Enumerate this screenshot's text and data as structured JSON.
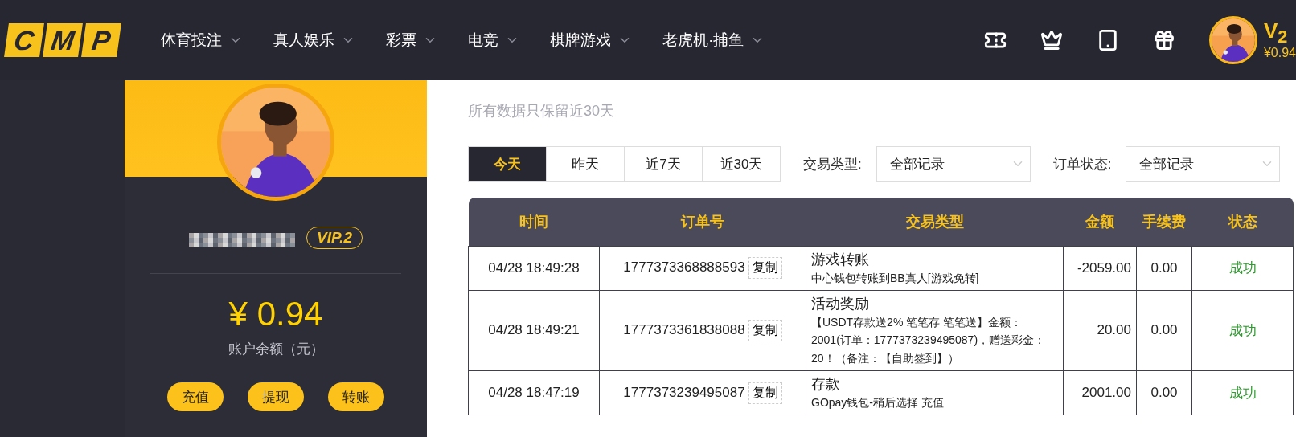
{
  "nav": {
    "logo_letters": [
      "C",
      "M",
      "P"
    ],
    "items": [
      {
        "label": "体育投注"
      },
      {
        "label": "真人娱乐"
      },
      {
        "label": "彩票"
      },
      {
        "label": "电竞"
      },
      {
        "label": "棋牌游戏"
      },
      {
        "label": "老虎机·捕鱼"
      }
    ]
  },
  "account": {
    "vip": "V$_{2}$",
    "balance": "¥0.94"
  },
  "profile": {
    "avatar": {
      "kind": "picture"
    },
    "vip_badge": "VIP.2",
    "balance": "¥ 0.94",
    "balance_label": "账户余额（元）",
    "actions": [
      "充值",
      "提现",
      "转账"
    ]
  },
  "records": {
    "subtitle": "所有数据只保留近30天",
    "tabs": [
      {
        "label": "今天",
        "selected": true
      },
      {
        "label": "昨天",
        "selected": false
      },
      {
        "label": "近7天",
        "selected": false
      },
      {
        "label": "近30天",
        "selected": false
      }
    ],
    "filters": [
      {
        "label": "交易类型:",
        "value": "全部记录"
      },
      {
        "label": "订单状态:",
        "value": "全部记录"
      }
    ],
    "table": {
      "columns": [
        "时间",
        "订单号",
        "交易类型",
        "金额",
        "手续费",
        "状态"
      ],
      "rows": [
        {
          "time": "04/28 18:49:28",
          "order_no": "1777373368888593",
          "copy": "复制",
          "type": "游戏转账",
          "detail": "中心钱包转账到BB真人[游戏免转]",
          "amount": "-2059.00",
          "fee": "0.00",
          "status": "成功"
        },
        {
          "time": "04/28 18:49:21",
          "order_no": "1777373361838088",
          "copy": "复制",
          "type": "活动奖励",
          "detail": "【USDT存款送2% 笔笔存 笔笔送】金额：2001(订单：1777373239495087)，赠送彩金：20！（备注：【自助签到】）",
          "amount": "20.00",
          "fee": "0.00",
          "status": "成功"
        },
        {
          "time": "04/28 18:47:19",
          "order_no": "1777373239495087",
          "copy": "复制",
          "type": "存款",
          "detail": "GOpay钱包-稍后选择 充值",
          "amount": "2001.00",
          "fee": "0.00",
          "status": "成功"
        }
      ]
    }
  }
}
